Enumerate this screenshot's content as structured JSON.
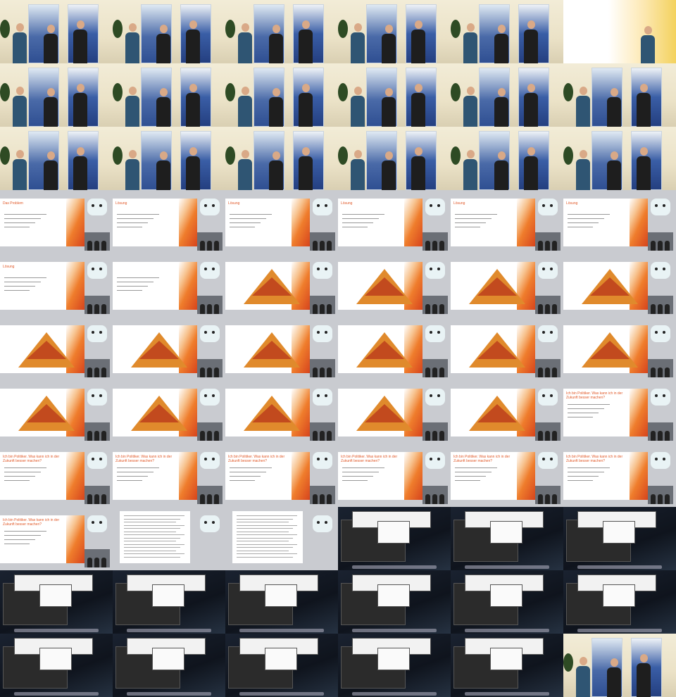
{
  "image": {
    "kind": "video contact sheet",
    "columns": 6,
    "rows": 11,
    "tiles": [
      {
        "type": "stage"
      },
      {
        "type": "stage"
      },
      {
        "type": "stage"
      },
      {
        "type": "stage"
      },
      {
        "type": "stage"
      },
      {
        "type": "whitefade"
      },
      {
        "type": "stage"
      },
      {
        "type": "stage"
      },
      {
        "type": "stage"
      },
      {
        "type": "stage"
      },
      {
        "type": "stage"
      },
      {
        "type": "stage"
      },
      {
        "type": "stage"
      },
      {
        "type": "stage"
      },
      {
        "type": "stage"
      },
      {
        "type": "stage"
      },
      {
        "type": "stage"
      },
      {
        "type": "stage"
      },
      {
        "type": "slide",
        "title": "Das Problem"
      },
      {
        "type": "slide",
        "title": "Lösung"
      },
      {
        "type": "slide",
        "title": "Lösung"
      },
      {
        "type": "slide",
        "title": "Lösung"
      },
      {
        "type": "slide",
        "title": "Lösung"
      },
      {
        "type": "slide",
        "title": "Lösung"
      },
      {
        "type": "slide",
        "title": "Lösung"
      },
      {
        "type": "slide",
        "title": ""
      },
      {
        "type": "pyramid"
      },
      {
        "type": "pyramid"
      },
      {
        "type": "pyramid"
      },
      {
        "type": "pyramid"
      },
      {
        "type": "pyramid"
      },
      {
        "type": "pyramid"
      },
      {
        "type": "pyramid"
      },
      {
        "type": "pyramid"
      },
      {
        "type": "pyramid"
      },
      {
        "type": "pyramid"
      },
      {
        "type": "pyramid"
      },
      {
        "type": "pyramid"
      },
      {
        "type": "pyramid"
      },
      {
        "type": "pyramid"
      },
      {
        "type": "pyramid"
      },
      {
        "type": "slide",
        "title": "Ich bin Politiker. Was kann ich in der Zukunft besser machen?"
      },
      {
        "type": "slide",
        "title": "Ich bin Politiker. Was kann ich in der Zukunft besser machen?"
      },
      {
        "type": "slide",
        "title": "Ich bin Politiker. Was kann ich in der Zukunft besser machen?"
      },
      {
        "type": "slide",
        "title": "Ich bin Politiker. Was kann ich in der Zukunft besser machen?"
      },
      {
        "type": "slide",
        "title": "Ich bin Politiker. Was kann ich in der Zukunft besser machen?"
      },
      {
        "type": "slide",
        "title": "Ich bin Politiker. Was kann ich in der Zukunft besser machen?"
      },
      {
        "type": "slide",
        "title": "Ich bin Politiker. Was kann ich in der Zukunft besser machen?"
      },
      {
        "type": "slide",
        "title": "Ich bin Politiker. Was kann ich in der Zukunft besser machen?"
      },
      {
        "type": "doc"
      },
      {
        "type": "doc"
      },
      {
        "type": "desk"
      },
      {
        "type": "desk"
      },
      {
        "type": "desk"
      },
      {
        "type": "desk"
      },
      {
        "type": "desk"
      },
      {
        "type": "desk"
      },
      {
        "type": "desk"
      },
      {
        "type": "desk"
      },
      {
        "type": "desk"
      },
      {
        "type": "desk"
      },
      {
        "type": "desk"
      },
      {
        "type": "desk"
      },
      {
        "type": "desk"
      },
      {
        "type": "desk"
      },
      {
        "type": "stage"
      }
    ]
  },
  "colors": {
    "slide_accent": "#e15a2a",
    "pyramid_orange": "#e08a2c",
    "pyramid_red": "#c24a1e",
    "banner_blue": "#2f4f92",
    "desktop_bg": "#0f141d"
  }
}
